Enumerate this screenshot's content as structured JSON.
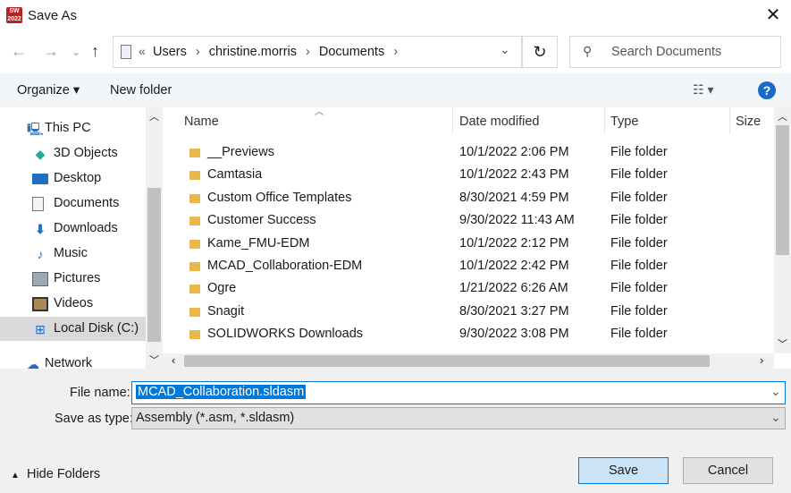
{
  "window": {
    "title": "Save As",
    "app_icon_text": "SW 2022"
  },
  "address": {
    "overflow": "«",
    "crumbs": [
      "Users",
      "christine.morris",
      "Documents"
    ]
  },
  "search": {
    "placeholder": "Search Documents"
  },
  "toolbar": {
    "organize": "Organize",
    "new_folder": "New folder",
    "help": "?"
  },
  "sidebar": {
    "items": [
      {
        "label": "This PC",
        "icon": "computer-icon"
      },
      {
        "label": "3D Objects",
        "icon": "cube-icon"
      },
      {
        "label": "Desktop",
        "icon": "desktop-icon"
      },
      {
        "label": "Documents",
        "icon": "document-icon"
      },
      {
        "label": "Downloads",
        "icon": "download-icon"
      },
      {
        "label": "Music",
        "icon": "music-icon"
      },
      {
        "label": "Pictures",
        "icon": "picture-icon"
      },
      {
        "label": "Videos",
        "icon": "video-icon"
      },
      {
        "label": "Local Disk (C:)",
        "icon": "disk-icon",
        "selected": true
      },
      {
        "label": "Network",
        "icon": "network-icon"
      }
    ]
  },
  "columns": {
    "name": "Name",
    "date": "Date modified",
    "type": "Type",
    "size": "Size"
  },
  "files": [
    {
      "name": "__Previews",
      "date": "10/1/2022 2:06 PM",
      "type": "File folder"
    },
    {
      "name": "Camtasia",
      "date": "10/1/2022 2:43 PM",
      "type": "File folder"
    },
    {
      "name": "Custom Office Templates",
      "date": "8/30/2021 4:59 PM",
      "type": "File folder"
    },
    {
      "name": "Customer Success",
      "date": "9/30/2022 11:43 AM",
      "type": "File folder"
    },
    {
      "name": "Kame_FMU-EDM",
      "date": "10/1/2022 2:12 PM",
      "type": "File folder"
    },
    {
      "name": "MCAD_Collaboration-EDM",
      "date": "10/1/2022 2:42 PM",
      "type": "File folder"
    },
    {
      "name": "Ogre",
      "date": "1/21/2022 6:26 AM",
      "type": "File folder"
    },
    {
      "name": "Snagit",
      "date": "8/30/2021 3:27 PM",
      "type": "File folder"
    },
    {
      "name": "SOLIDWORKS Downloads",
      "date": "9/30/2022 3:08 PM",
      "type": "File folder"
    }
  ],
  "form": {
    "file_name_label": "File name:",
    "file_name_value": "MCAD_Collaboration.sldasm",
    "type_label": "Save as type:",
    "type_value": "Assembly (*.asm, *.sldasm)"
  },
  "footer": {
    "hide_folders": "Hide Folders",
    "save": "Save",
    "cancel": "Cancel"
  }
}
